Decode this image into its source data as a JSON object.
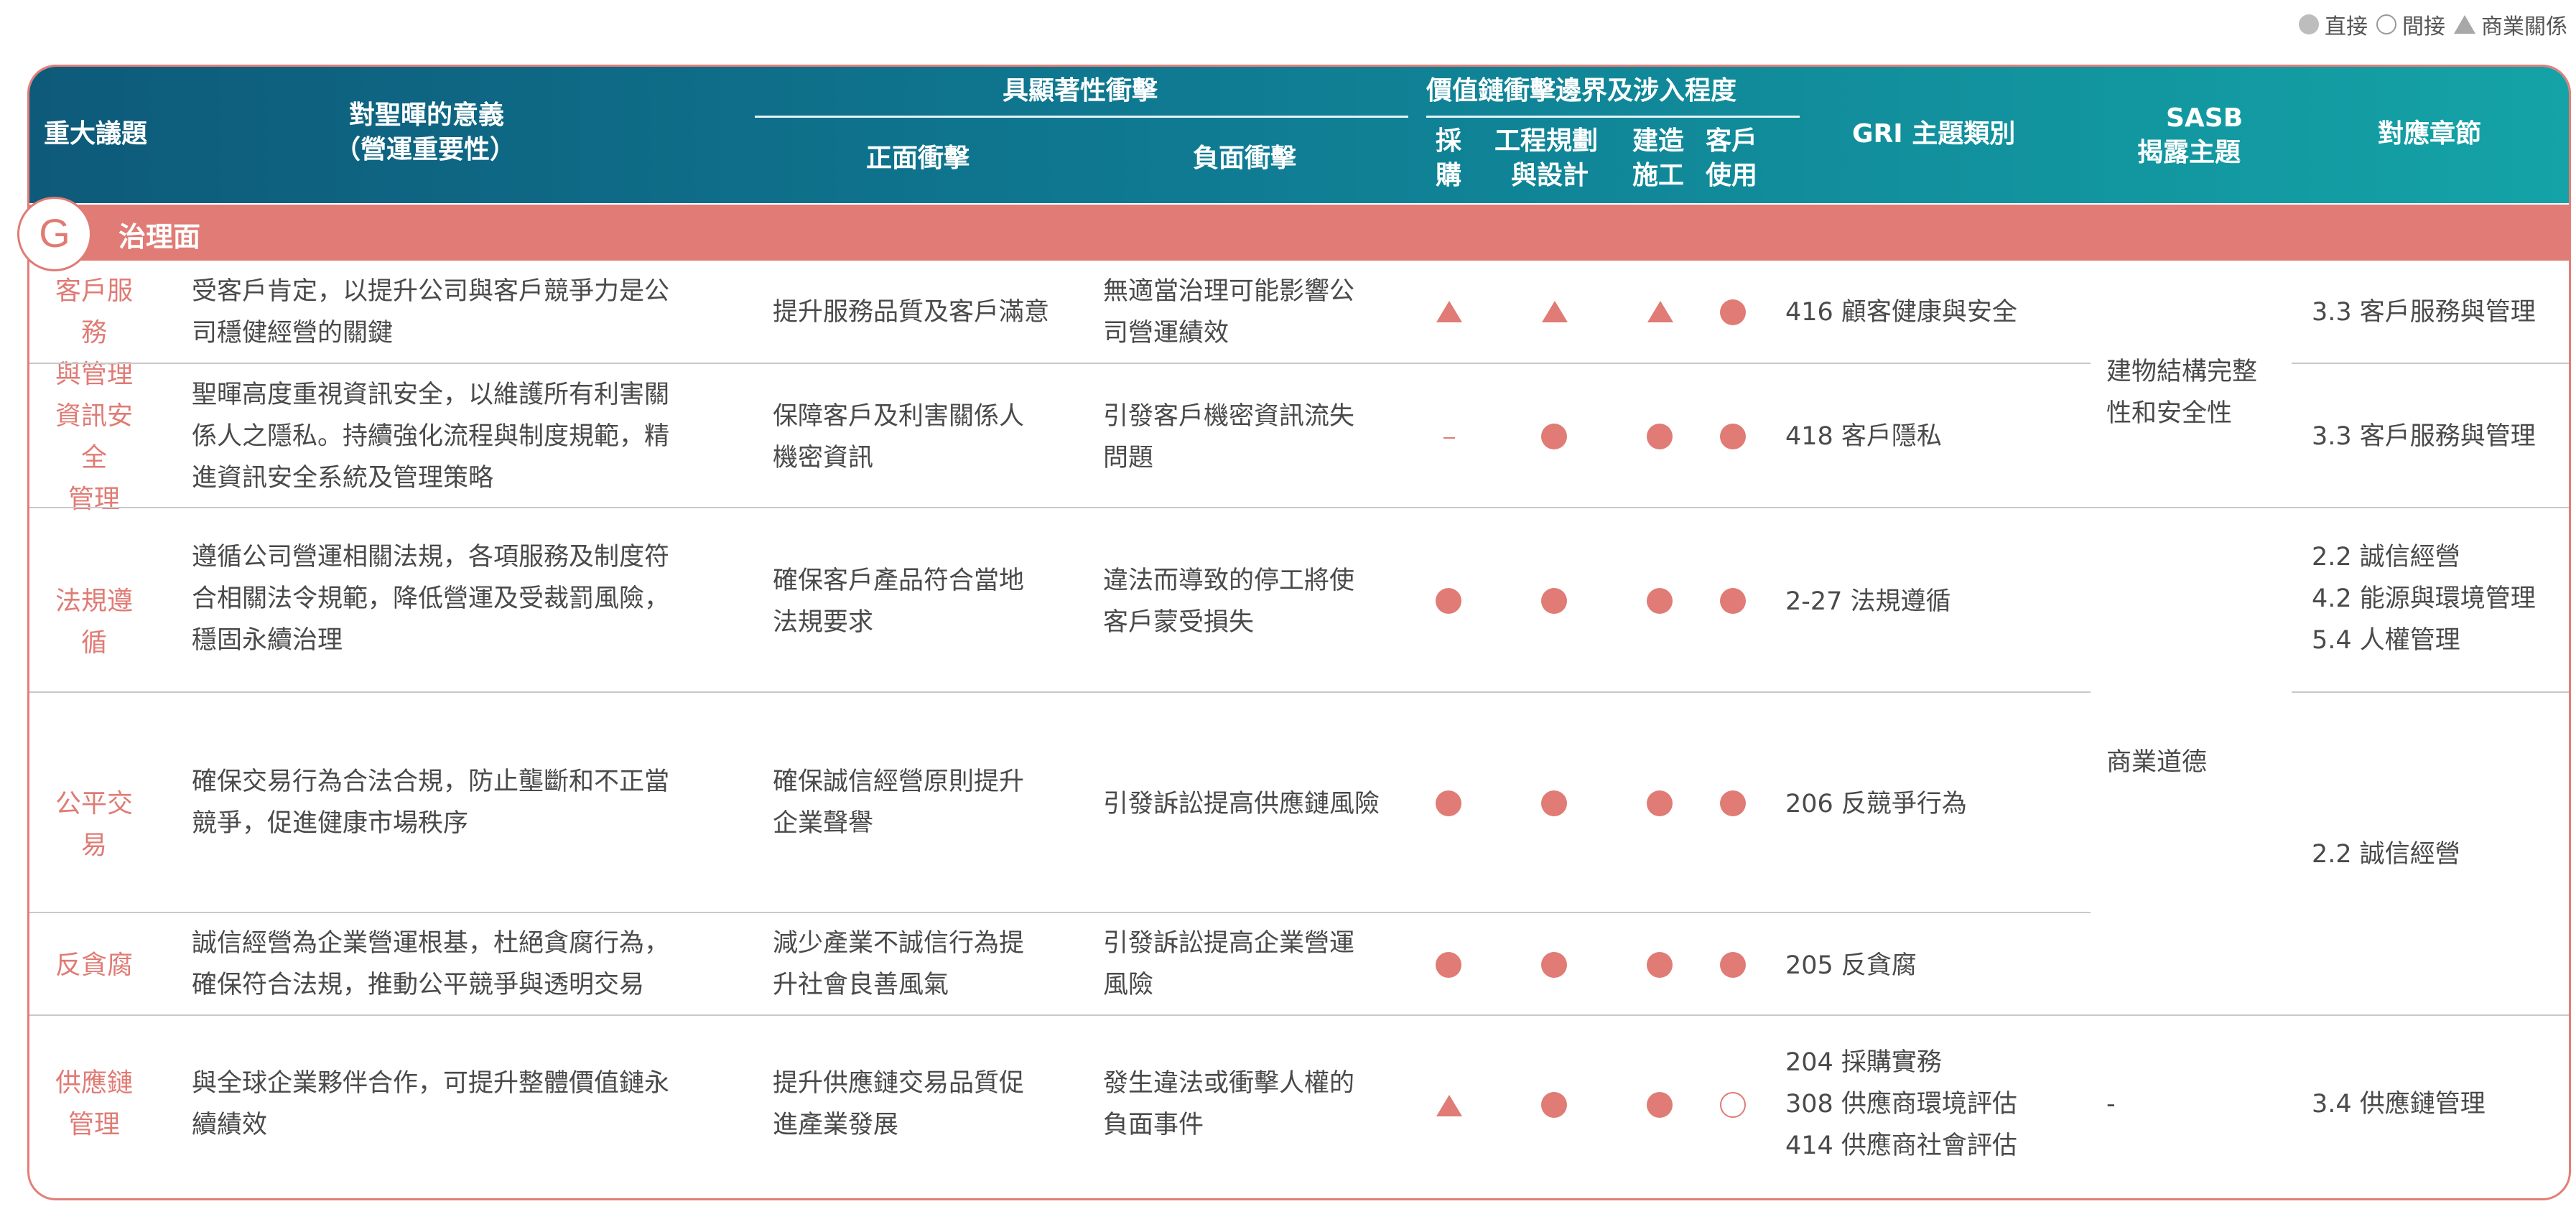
{
  "legend": {
    "direct": "直接",
    "indirect": "間接",
    "business": "商業關係"
  },
  "header": {
    "topic": "重大議題",
    "meaning_l1": "對聖暉的意義",
    "meaning_l2": "（營運重要性）",
    "impact": "具顯著性衝擊",
    "positive": "正面衝擊",
    "negative": "負面衝擊",
    "value_chain": "價值鏈衝擊邊界及涉入程度",
    "vc_purchase_l1": "採",
    "vc_purchase_l2": "購",
    "vc_engineering_l1": "工程規劃",
    "vc_engineering_l2": "與設計",
    "vc_construction_l1": "建造",
    "vc_construction_l2": "施工",
    "vc_customer_l1": "客戶",
    "vc_customer_l2": "使用",
    "gri": "GRI 主題類別",
    "sasb_l1": "SASB",
    "sasb_l2": "揭露主題",
    "chapter": "對應章節"
  },
  "section": {
    "badge": "G",
    "label": "治理面"
  },
  "rows": [
    {
      "topic_l1": "客戶服務",
      "topic_l2": "與管理",
      "meaning_l1": "受客戶肯定，以提升公司與客戶競爭力是公",
      "meaning_l2": "司穩健經營的關鍵",
      "meaning_l3": "",
      "positive_l1": "提升服務品質及客戶滿意",
      "positive_l2": "",
      "negative_l1": "無適當治理可能影響公",
      "negative_l2": "司營運績效",
      "marks": [
        "triangle",
        "triangle",
        "triangle",
        "dot"
      ],
      "gri_l1": "416 顧客健康與安全",
      "gri_l2": "",
      "gri_l3": "",
      "chapter_l1": "3.3 客戶服務與管理",
      "chapter_l2": "",
      "chapter_l3": ""
    },
    {
      "topic_l1": "資訊安全",
      "topic_l2": "管理",
      "meaning_l1": "聖暉高度重視資訊安全，以維護所有利害關",
      "meaning_l2": "係人之隱私。持續強化流程與制度規範，精",
      "meaning_l3": "進資訊安全系統及管理策略",
      "positive_l1": "保障客戶及利害關係人",
      "positive_l2": "機密資訊",
      "negative_l1": "引發客戶機密資訊流失",
      "negative_l2": "問題",
      "marks": [
        "dash",
        "dot",
        "dot",
        "dot"
      ],
      "gri_l1": "418 客戶隱私",
      "gri_l2": "",
      "gri_l3": "",
      "chapter_l1": "3.3 客戶服務與管理",
      "chapter_l2": "",
      "chapter_l3": ""
    },
    {
      "topic_l1": "法規遵循",
      "topic_l2": "",
      "meaning_l1": "遵循公司營運相關法規，各項服務及制度符",
      "meaning_l2": "合相關法令規範，降低營運及受裁罰風險，",
      "meaning_l3": "穩固永續治理",
      "positive_l1": "確保客戶產品符合當地",
      "positive_l2": "法規要求",
      "negative_l1": "違法而導致的停工將使",
      "negative_l2": "客戶蒙受損失",
      "marks": [
        "dot",
        "dot",
        "dot",
        "dot"
      ],
      "gri_l1": "2-27 法規遵循",
      "gri_l2": "",
      "gri_l3": "",
      "chapter_l1": "2.2 誠信經營",
      "chapter_l2": "4.2 能源與環境管理",
      "chapter_l3": "5.4 人權管理"
    },
    {
      "topic_l1": "公平交易",
      "topic_l2": "",
      "meaning_l1": "確保交易行為合法合規，防止壟斷和不正當",
      "meaning_l2": "競爭，促進健康市場秩序",
      "meaning_l3": "",
      "positive_l1": "確保誠信經營原則提升",
      "positive_l2": "企業聲譽",
      "negative_l1": "引發訴訟提高供應鏈風險",
      "negative_l2": "",
      "marks": [
        "dot",
        "dot",
        "dot",
        "dot"
      ],
      "gri_l1": "206 反競爭行為",
      "gri_l2": "",
      "gri_l3": "",
      "chapter_l1": "",
      "chapter_l2": "",
      "chapter_l3": ""
    },
    {
      "topic_l1": "反貪腐",
      "topic_l2": "",
      "meaning_l1": "誠信經營為企業營運根基，杜絕貪腐行為，",
      "meaning_l2": "確保符合法規，推動公平競爭與透明交易",
      "meaning_l3": "",
      "positive_l1": "減少產業不誠信行為提",
      "positive_l2": "升社會良善風氣",
      "negative_l1": "引發訴訟提高企業營運",
      "negative_l2": "風險",
      "marks": [
        "dot",
        "dot",
        "dot",
        "dot"
      ],
      "gri_l1": "205 反貪腐",
      "gri_l2": "",
      "gri_l3": "",
      "chapter_l1": "",
      "chapter_l2": "",
      "chapter_l3": ""
    },
    {
      "topic_l1": "供應鏈",
      "topic_l2": "管理",
      "meaning_l1": "與全球企業夥伴合作，可提升整體價值鏈永",
      "meaning_l2": "續績效",
      "meaning_l3": "",
      "positive_l1": "提升供應鏈交易品質促",
      "positive_l2": "進產業發展",
      "negative_l1": "發生違法或衝擊人權的",
      "negative_l2": "負面事件",
      "marks": [
        "triangle",
        "dot",
        "dot",
        "ring"
      ],
      "gri_l1": "204 採購實務",
      "gri_l2": "308 供應商環境評估",
      "gri_l3": "414 供應商社會評估",
      "chapter_l1": "3.4 供應鏈管理",
      "chapter_l2": "",
      "chapter_l3": ""
    }
  ],
  "merged": {
    "sasb_group1_l1": "建物結構完整",
    "sasb_group1_l2": "性和安全性",
    "sasb_group2": "商業道德",
    "sasb_last": "-",
    "chapter_group": "2.2 誠信經營"
  }
}
